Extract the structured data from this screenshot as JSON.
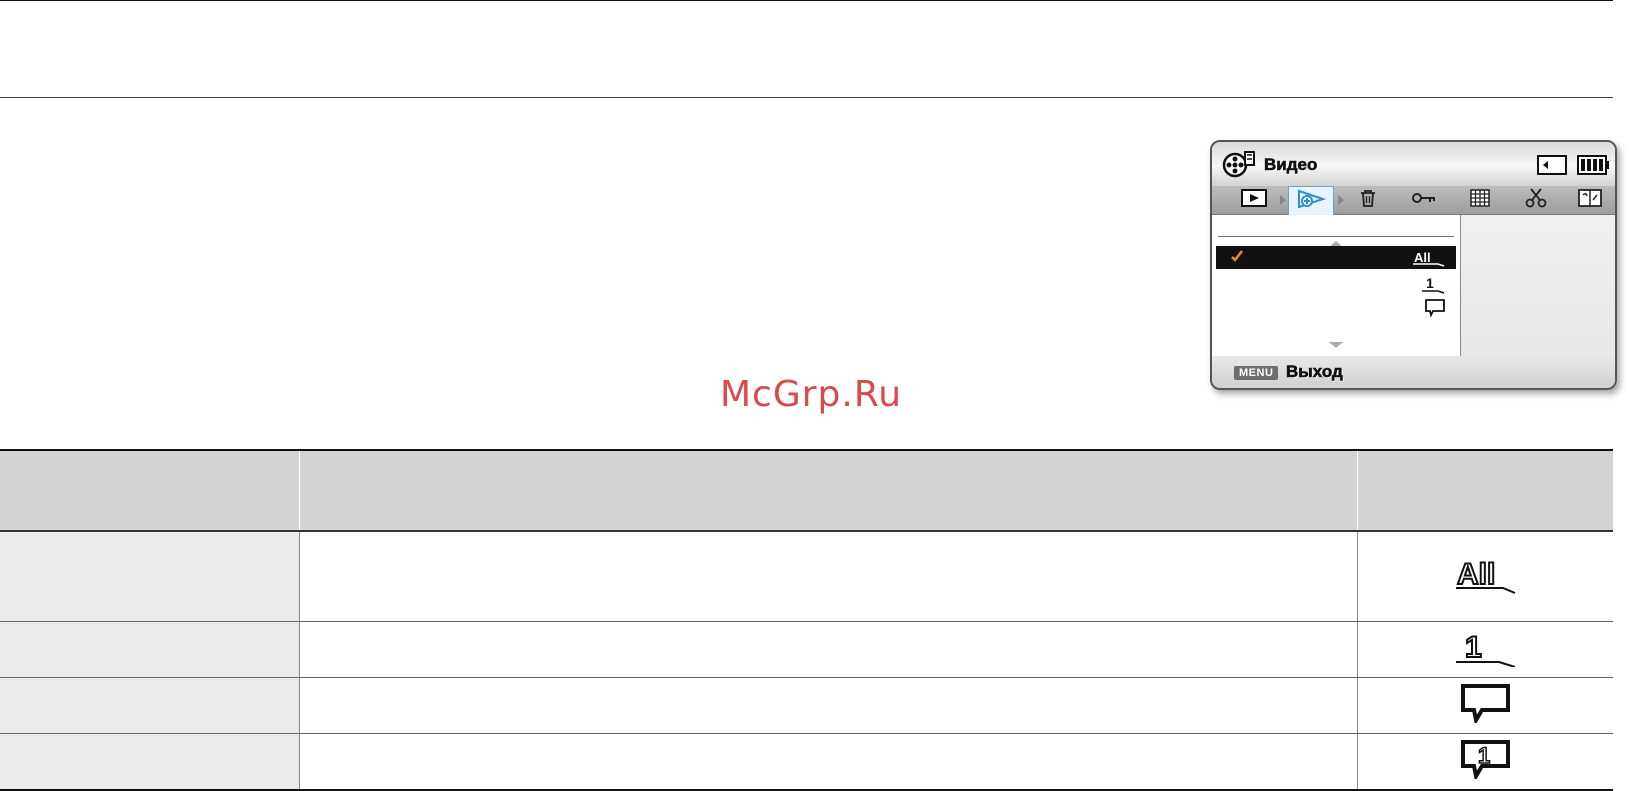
{
  "watermark": "McGrp.Ru",
  "lcd": {
    "title": "Видео",
    "footer_key": "MENU",
    "footer_label": "Выход",
    "tabs": [
      {
        "icon": "play-icon"
      },
      {
        "icon": "protect-share-icon",
        "active": true
      },
      {
        "icon": "trash-icon"
      },
      {
        "icon": "key-icon"
      },
      {
        "icon": "grid-icon"
      },
      {
        "icon": "scissors-icon"
      },
      {
        "icon": "book-icon"
      }
    ],
    "menu_items": [
      {
        "icon_label": "All",
        "selected": true
      },
      {
        "icon_label": "1"
      },
      {
        "icon_label": ""
      }
    ]
  },
  "table": {
    "rows": [
      {
        "icon": "all-select-icon",
        "icon_label": "All"
      },
      {
        "icon": "single-select-icon",
        "icon_label": "1"
      },
      {
        "icon": "speech-box-icon"
      },
      {
        "icon": "speech-box-one-icon",
        "icon_label": "1"
      }
    ]
  },
  "colors": {
    "accent_blue": "#2a8fd6",
    "check_orange": "#f08a1c",
    "watermark_red": "#d83a3a"
  }
}
